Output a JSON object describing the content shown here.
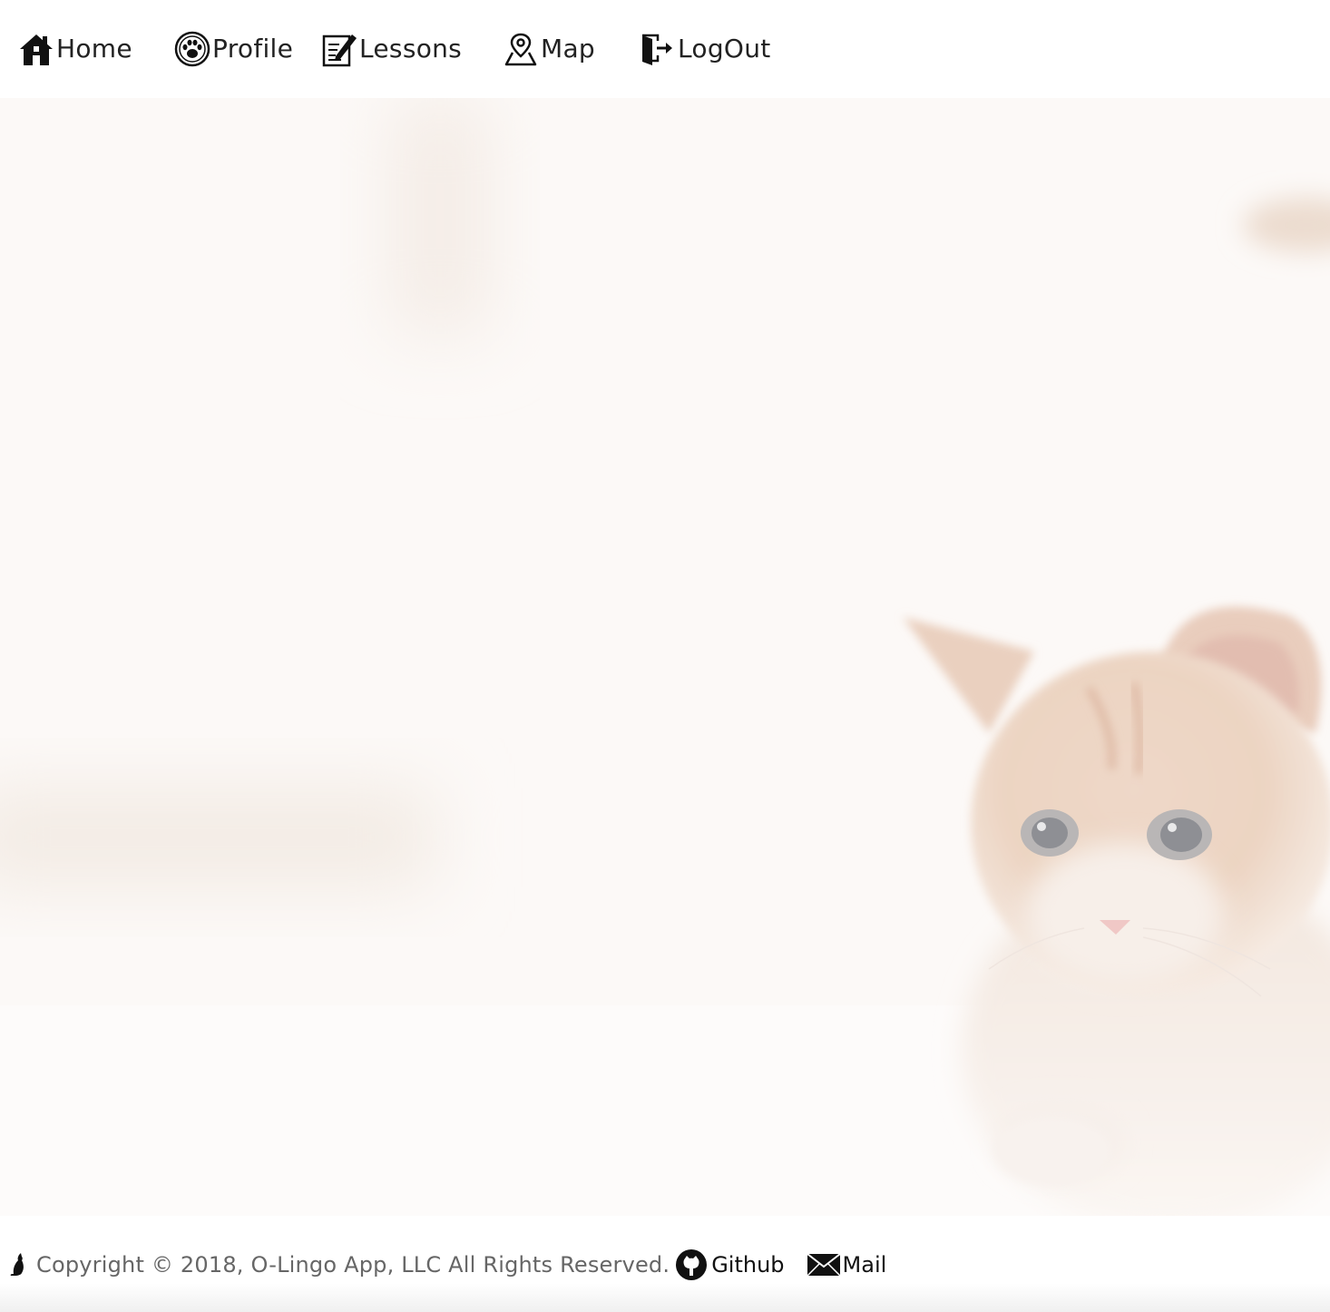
{
  "nav": {
    "items": [
      {
        "label": "Home",
        "icon": "home-icon"
      },
      {
        "label": "Profile",
        "icon": "paw-icon"
      },
      {
        "label": "Lessons",
        "icon": "edit-document-icon"
      },
      {
        "label": "Map",
        "icon": "map-pin-icon"
      },
      {
        "label": "LogOut",
        "icon": "logout-door-icon"
      }
    ]
  },
  "hero": {
    "image": "faded-kitten-background"
  },
  "footer": {
    "logo_icon": "cat-silhouette-icon",
    "copyright": "Copyright © 2018, O-Lingo App, LLC All Rights Reserved.",
    "github_label": "Github",
    "github_icon": "github-icon",
    "mail_label": "Mail",
    "mail_icon": "envelope-icon"
  },
  "colors": {
    "background": "#ffffff",
    "hero_tint": "#fcf9f7",
    "cat_fur": "#ecd2c0",
    "text": "#222222",
    "footer_text": "#666666"
  }
}
